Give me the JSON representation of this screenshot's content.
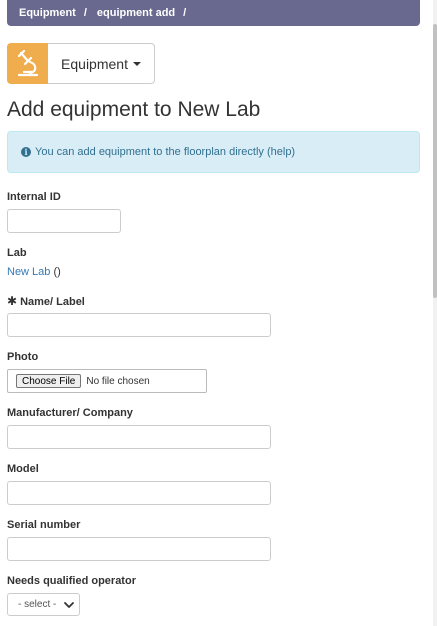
{
  "breadcrumb": {
    "items": [
      "Equipment",
      "equipment add"
    ],
    "separator": "/"
  },
  "app": {
    "icon": "microscope-icon",
    "name": "Equipment",
    "accent": "#f0ad4e"
  },
  "page": {
    "title": "Add equipment to New Lab"
  },
  "info": {
    "icon": "info-circle-icon",
    "text": "You can add equipment to the floorplan directly (help)"
  },
  "form": {
    "internal_id": {
      "label": "Internal ID",
      "value": ""
    },
    "lab": {
      "label": "Lab",
      "link": "New Lab",
      "suffix": " ()"
    },
    "name": {
      "required_mark": "✱",
      "label": "Name/ Label",
      "value": ""
    },
    "photo": {
      "label": "Photo",
      "button": "Choose File",
      "status": "No file chosen"
    },
    "manufacturer": {
      "label": "Manufacturer/ Company",
      "value": ""
    },
    "model": {
      "label": "Model",
      "value": ""
    },
    "serial": {
      "label": "Serial number",
      "value": ""
    },
    "qualified_operator": {
      "label": "Needs qualified operator",
      "selected": "- select -"
    }
  },
  "colors": {
    "breadcrumb_bg": "#69698f",
    "info_bg": "#d9edf7",
    "info_text": "#31708f",
    "link": "#337ab7"
  }
}
